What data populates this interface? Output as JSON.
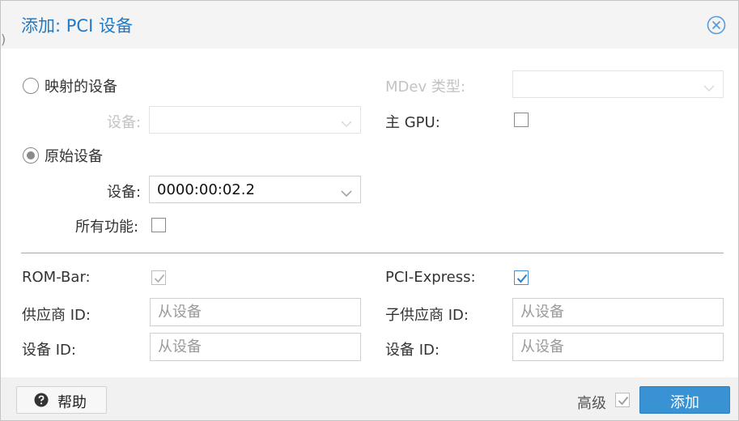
{
  "dialog": {
    "title": "添加: PCI 设备",
    "edge_glyph": ")"
  },
  "source": {
    "mapped_label": "映射的设备",
    "mapped_device_label": "设备:",
    "mapped_device_value": "",
    "raw_label": "原始设备",
    "raw_selected": true,
    "raw_device_label": "设备:",
    "raw_device_value": "0000:00:02.2",
    "all_functions_label": "所有功能:",
    "all_functions_checked": false
  },
  "right_top": {
    "mdev_label": "MDev 类型:",
    "mdev_value": "",
    "primary_gpu_label": "主 GPU:",
    "primary_gpu_checked": false
  },
  "advanced": {
    "rombar_label": "ROM-Bar:",
    "rombar_checked": true,
    "pcie_label": "PCI-Express:",
    "pcie_checked": true,
    "vendor_id_label": "供应商 ID:",
    "vendor_id_placeholder": "从设备",
    "sub_vendor_id_label": "子供应商 ID:",
    "sub_vendor_id_placeholder": "从设备",
    "device_id_label": "设备 ID:",
    "device_id_placeholder": "从设备",
    "sub_device_id_label": "设备 ID:",
    "sub_device_id_placeholder": "从设备"
  },
  "footer": {
    "help_label": "帮助",
    "advanced_label": "高级",
    "advanced_checked": true,
    "add_label": "添加"
  },
  "colors": {
    "accent": "#1f7ac7",
    "primary_button": "#3892d4",
    "disabled_text": "#c3c3c3"
  }
}
